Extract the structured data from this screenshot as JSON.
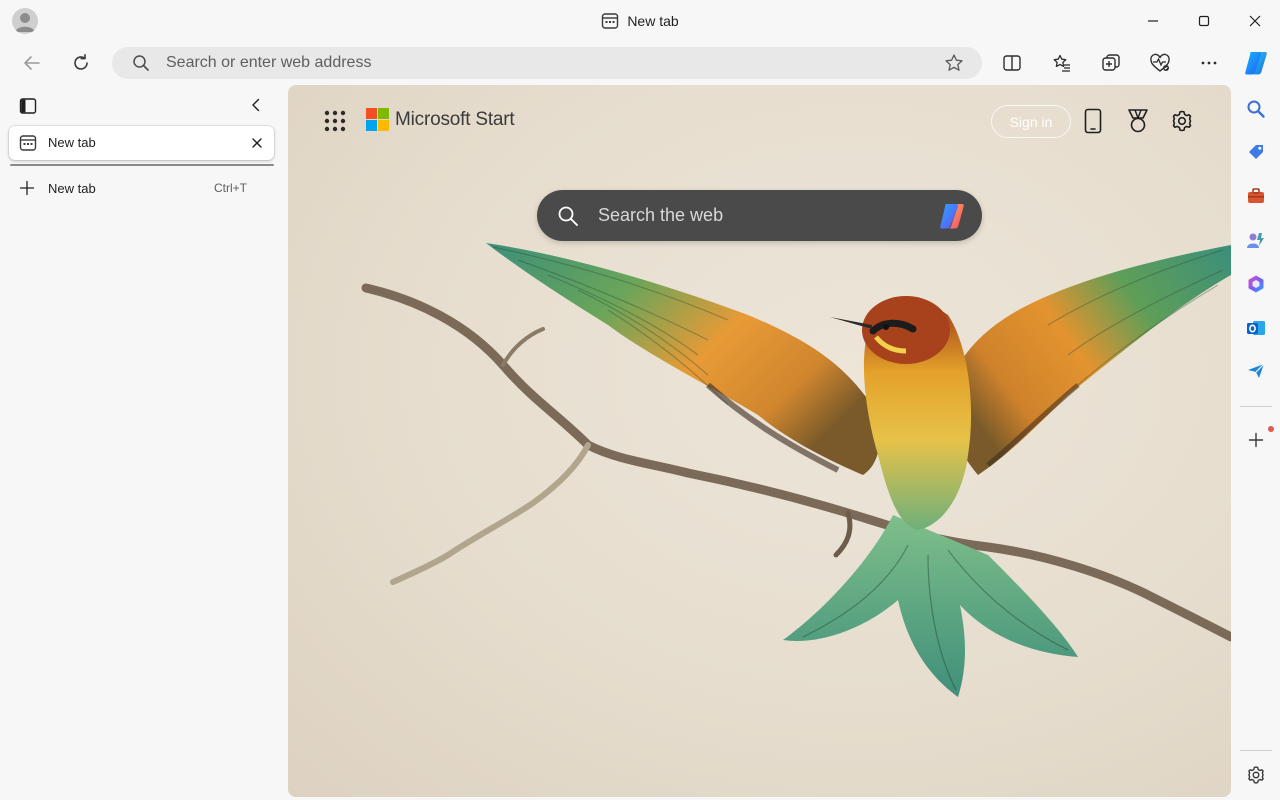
{
  "window": {
    "title": "New tab",
    "controls": [
      "minimize-icon",
      "maximize-icon",
      "close-icon"
    ]
  },
  "toolbar": {
    "address_placeholder": "Search or enter web address",
    "buttons": [
      "back-icon",
      "refresh-icon",
      "split-screen-icon",
      "favorites-icon",
      "collections-icon",
      "browser-essentials-icon",
      "more-icon",
      "copilot-icon"
    ]
  },
  "tabs_panel": {
    "active_tab": {
      "label": "New tab"
    },
    "new_tab": {
      "label": "New tab",
      "shortcut": "Ctrl+T"
    }
  },
  "content": {
    "brand": "Microsoft Start",
    "sign_in_label": "Sign in",
    "search_placeholder": "Search the web",
    "buttons": [
      "apps-launcher-icon",
      "phone-icon",
      "rewards-icon",
      "settings-gear-icon"
    ]
  },
  "sidebar": {
    "items": [
      "search-icon",
      "shopping-tag-icon",
      "tools-icon",
      "games-icon",
      "microsoft-365-icon",
      "outlook-icon",
      "drop-icon",
      "add-icon",
      "settings-icon"
    ]
  },
  "colors": {
    "background": "#f7f7f7",
    "address_bar": "#e8e8e8",
    "search_box": "#4a4a4a",
    "ms_red": "#f25022",
    "ms_green": "#7fba00",
    "ms_blue": "#00a4ef",
    "ms_yellow": "#ffb900"
  }
}
